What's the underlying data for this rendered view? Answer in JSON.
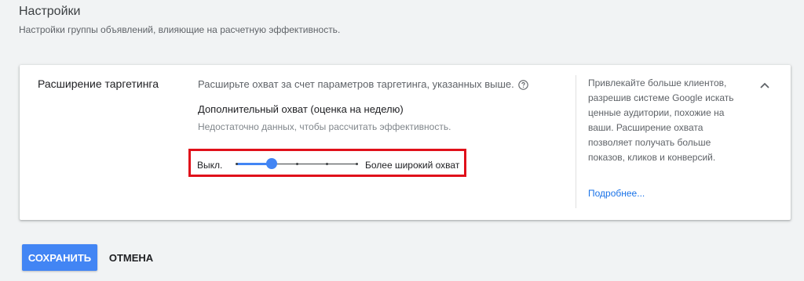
{
  "header": {
    "title": "Настройки",
    "subtitle": "Настройки группы объявлений, влияющие на расчетную эффективность."
  },
  "targeting": {
    "title": "Расширение таргетинга",
    "description": "Расширьте охват за счет параметров таргетинга, указанных выше.",
    "help_icon": "help-circle-icon",
    "reach_title": "Дополнительный охват (оценка на неделю)",
    "reach_note": "Недостаточно данных, чтобы рассчитать эффективность.",
    "slider": {
      "min_label": "Выкл.",
      "max_label": "Более широкий охват",
      "steps": 5,
      "value_index": 1,
      "accent_color": "#4285f4",
      "highlight_color": "#e0101a"
    },
    "side_text": "Привлекайте больше клиентов, разрешив системе Google искать ценные аудитории, похожие на ваши. Расширение охвата позволяет получать больше показов, кликов и конверсий.",
    "learn_more": "Подробнее...",
    "collapse_icon": "chevron-up-icon"
  },
  "actions": {
    "save_label": "СОХРАНИТЬ",
    "cancel_label": "ОТМЕНА"
  }
}
